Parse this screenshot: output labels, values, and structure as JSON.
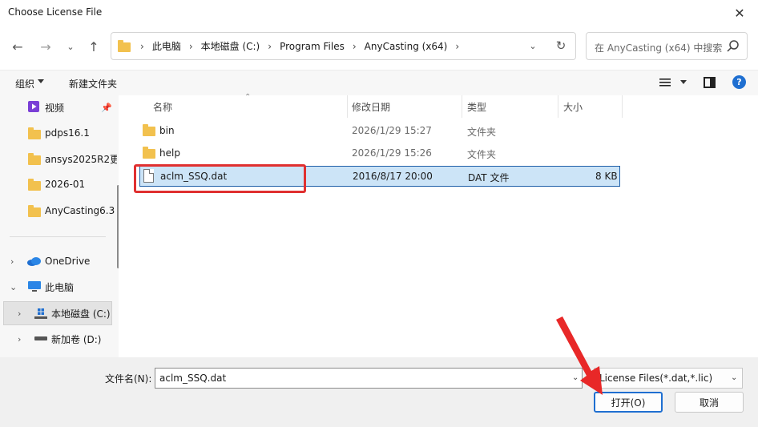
{
  "window": {
    "title": "Choose License File"
  },
  "address": {
    "crumbs": [
      "此电脑",
      "本地磁盘 (C:)",
      "Program Files",
      "AnyCasting (x64)"
    ],
    "search_placeholder": "在 AnyCasting (x64) 中搜索"
  },
  "toolbar": {
    "organize": "组织",
    "new_folder": "新建文件夹",
    "help": "?"
  },
  "nav": {
    "items": [
      {
        "label": "视频"
      },
      {
        "label": "pdps16.1"
      },
      {
        "label": "ansys2025R2更"
      },
      {
        "label": "2026-01"
      },
      {
        "label": "AnyCasting6.3"
      },
      {
        "label": "OneDrive"
      },
      {
        "label": "此电脑"
      },
      {
        "label": "本地磁盘 (C:)"
      },
      {
        "label": "新加卷 (D:)"
      }
    ]
  },
  "columns": {
    "name": "名称",
    "modified": "修改日期",
    "type": "类型",
    "size": "大小"
  },
  "files": [
    {
      "name": "bin",
      "modified": "2026/1/29 15:27",
      "type": "文件夹",
      "size": ""
    },
    {
      "name": "help",
      "modified": "2026/1/29 15:26",
      "type": "文件夹",
      "size": ""
    },
    {
      "name": "aclm_SSQ.dat",
      "modified": "2016/8/17 20:00",
      "type": "DAT 文件",
      "size": "8 KB"
    }
  ],
  "bottom": {
    "filename_label": "文件名(N):",
    "filename_value": "aclm_SSQ.dat",
    "filter": "License Files(*.dat,*.lic)",
    "open": "打开(O)",
    "cancel": "取消"
  },
  "colors": {
    "accent": "#1f6fd1",
    "selection": "#cce4f7",
    "highlight": "#e03030",
    "folder": "#f2c14e"
  }
}
